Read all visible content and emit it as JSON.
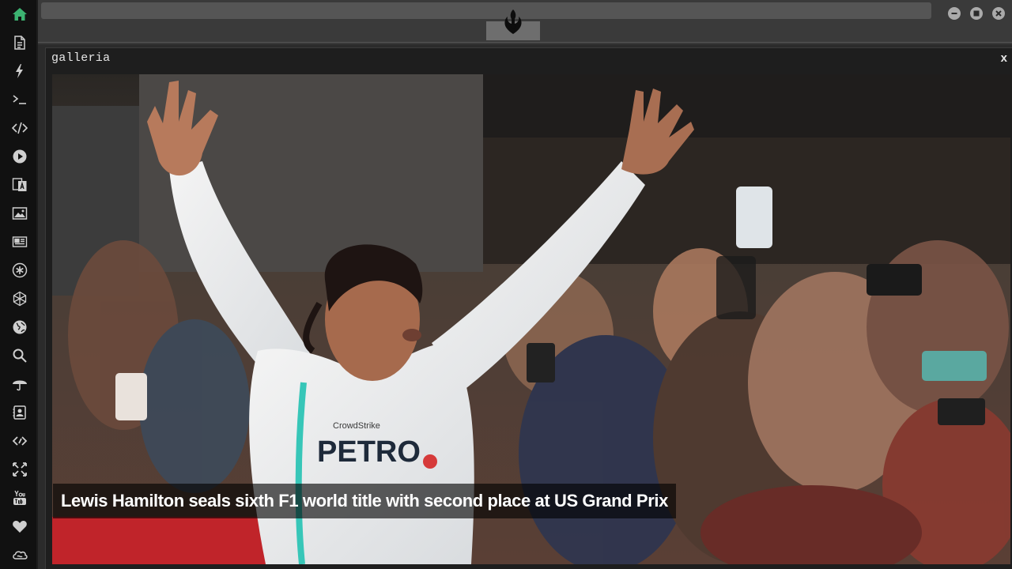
{
  "window": {
    "title": "galleria",
    "close_label": "x"
  },
  "gallery": {
    "caption": "Lewis Hamilton seals sixth F1 world title with second place at US Grand Prix"
  },
  "sidebar": {
    "icons": [
      "home-icon",
      "document-icon",
      "bolt-icon",
      "terminal-icon",
      "code-icon",
      "play-icon",
      "translate-icon",
      "image-icon",
      "newspaper-icon",
      "asterisk-icon",
      "network-icon",
      "globe-icon",
      "search-icon",
      "umbrella-icon",
      "contact-icon",
      "embed-icon",
      "expand-icon",
      "youtube-icon",
      "heart-icon",
      "cloud-icon"
    ]
  },
  "colors": {
    "active_icon": "#3cb371",
    "icon": "#cfcfcf",
    "background": "#2b2b2b",
    "sidebar": "#111111"
  }
}
